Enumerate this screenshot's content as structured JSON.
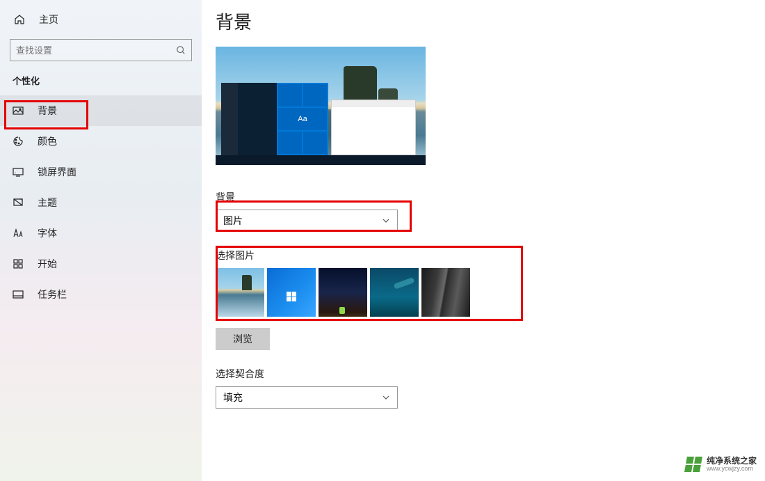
{
  "home": {
    "label": "主页"
  },
  "search": {
    "placeholder": "查找设置"
  },
  "category": {
    "title": "个性化"
  },
  "nav": [
    {
      "label": "背景"
    },
    {
      "label": "颜色"
    },
    {
      "label": "锁屏界面"
    },
    {
      "label": "主题"
    },
    {
      "label": "字体"
    },
    {
      "label": "开始"
    },
    {
      "label": "任务栏"
    }
  ],
  "page": {
    "title": "背景"
  },
  "preview": {
    "sample_text": "Aa"
  },
  "bg_section": {
    "label": "背景",
    "selected": "图片"
  },
  "choose_image": {
    "label": "选择图片"
  },
  "browse": {
    "label": "浏览"
  },
  "fit_section": {
    "label": "选择契合度",
    "selected": "填充"
  },
  "watermark": {
    "name": "纯净系统之家",
    "url": "www.ycwjzy.com"
  }
}
